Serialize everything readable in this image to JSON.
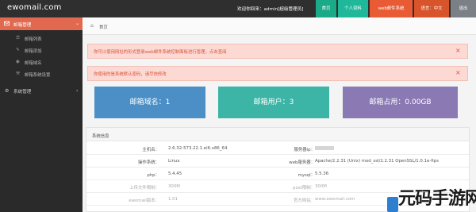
{
  "header": {
    "logo": "ewomail.com",
    "welcome": "欢迎你回来：admin[超级管理员]",
    "buttons": {
      "home": "首页",
      "profile": "个人资料",
      "sys": "web邮件系统",
      "lang": "语言：中文",
      "exit": "退出"
    }
  },
  "sidebar": {
    "group1": "邮箱管理",
    "items": [
      "邮箱列表",
      "邮箱添加",
      "邮箱域名",
      "邮箱系统设置"
    ],
    "group2": "系统管理"
  },
  "breadcrumb": "首页",
  "alerts": [
    "你可以使用网址的形式登录web邮件系统控制面板进行管理，点击查阅",
    "你使用的是系统默认密码，请尽快修改"
  ],
  "stats": [
    "邮箱域名：1",
    "邮箱用户：3",
    "邮箱占用：0.00GB"
  ],
  "sysinfo": {
    "title": "系统信息",
    "rows": [
      {
        "k1": "主机名：",
        "v1": "2.6.32-573.22.1.el6.x86_64",
        "k2": "服务器ip：",
        "v2": ""
      },
      {
        "k1": "操作系统：",
        "v1": "Linux",
        "k2": "web服务器：",
        "v2": "Apache/2.2.31 (Unix) mod_ssl/2.2.31 OpenSSL/1.0.1e-fips"
      },
      {
        "k1": "php：",
        "v1": "5.4.45",
        "k2": "mysql：",
        "v2": "5.5.36"
      },
      {
        "k1": "上传文件限制：",
        "v1": "300M",
        "k2": "post限制：",
        "v2": "300M"
      },
      {
        "k1": "ewomail版本：",
        "v1": "1.01",
        "k2": "官方网站：",
        "v2": "www.ewomail.com"
      }
    ]
  },
  "watermark": "元码手游网",
  "colors": {
    "topbar": "#2f2f2f",
    "sidebar": "#2a2a2a",
    "accent": "#e0694f",
    "stat1": "#4b8fc6",
    "stat2": "#3cb5a6",
    "stat3": "#8a79b3"
  }
}
